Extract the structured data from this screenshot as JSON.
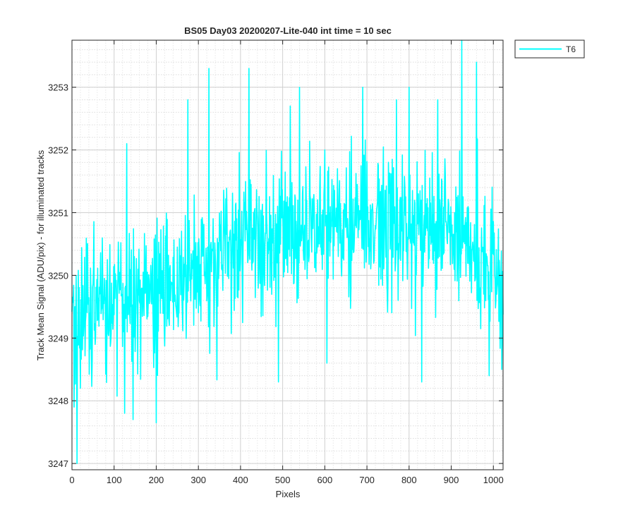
{
  "chart_data": {
    "type": "line",
    "title": "BS05 Day03 20200207-Lite-040 int time = 10 sec",
    "xlabel": "Pixels",
    "ylabel": "Track Mean Signal (ADU/pix) - for illuminated tracks",
    "xlim": [
      0,
      1023
    ],
    "ylim": [
      3246.9,
      3253.75
    ],
    "xticks": [
      0,
      100,
      200,
      300,
      400,
      500,
      600,
      700,
      800,
      900,
      1000
    ],
    "yticks": [
      3247,
      3248,
      3249,
      3250,
      3251,
      3252,
      3253
    ],
    "grid": {
      "major": true,
      "minor": true
    },
    "legend": {
      "placement": "outside-top-right"
    },
    "series": [
      {
        "name": "T6",
        "color": "#00ffff",
        "trend": [
          [
            0,
            3249.2
          ],
          [
            50,
            3249.5
          ],
          [
            100,
            3249.7
          ],
          [
            150,
            3249.7
          ],
          [
            200,
            3249.8
          ],
          [
            250,
            3250.0
          ],
          [
            300,
            3250.2
          ],
          [
            350,
            3250.3
          ],
          [
            400,
            3250.4
          ],
          [
            450,
            3250.6
          ],
          [
            500,
            3250.6
          ],
          [
            550,
            3250.7
          ],
          [
            600,
            3250.8
          ],
          [
            650,
            3250.9
          ],
          [
            700,
            3250.9
          ],
          [
            750,
            3250.8
          ],
          [
            800,
            3250.7
          ],
          [
            850,
            3250.7
          ],
          [
            900,
            3250.6
          ],
          [
            950,
            3250.4
          ],
          [
            1000,
            3250.0
          ],
          [
            1023,
            3249.6
          ]
        ],
        "noise_sd": 0.55,
        "peaks": [
          [
            5,
            3247.9
          ],
          [
            12,
            3247.0
          ],
          [
            20,
            3248.2
          ],
          [
            125,
            3247.8
          ],
          [
            130,
            3252.1
          ],
          [
            145,
            3247.7
          ],
          [
            200,
            3247.65
          ],
          [
            275,
            3252.8
          ],
          [
            325,
            3253.3
          ],
          [
            420,
            3253.3
          ],
          [
            490,
            3248.3
          ],
          [
            518,
            3252.7
          ],
          [
            540,
            3253.0
          ],
          [
            600,
            3252.0
          ],
          [
            605,
            3248.6
          ],
          [
            690,
            3253.0
          ],
          [
            770,
            3252.8
          ],
          [
            800,
            3253.0
          ],
          [
            830,
            3248.3
          ],
          [
            868,
            3252.8
          ],
          [
            925,
            3253.75
          ],
          [
            960,
            3253.4
          ],
          [
            990,
            3248.4
          ],
          [
            1020,
            3248.5
          ]
        ]
      }
    ]
  }
}
